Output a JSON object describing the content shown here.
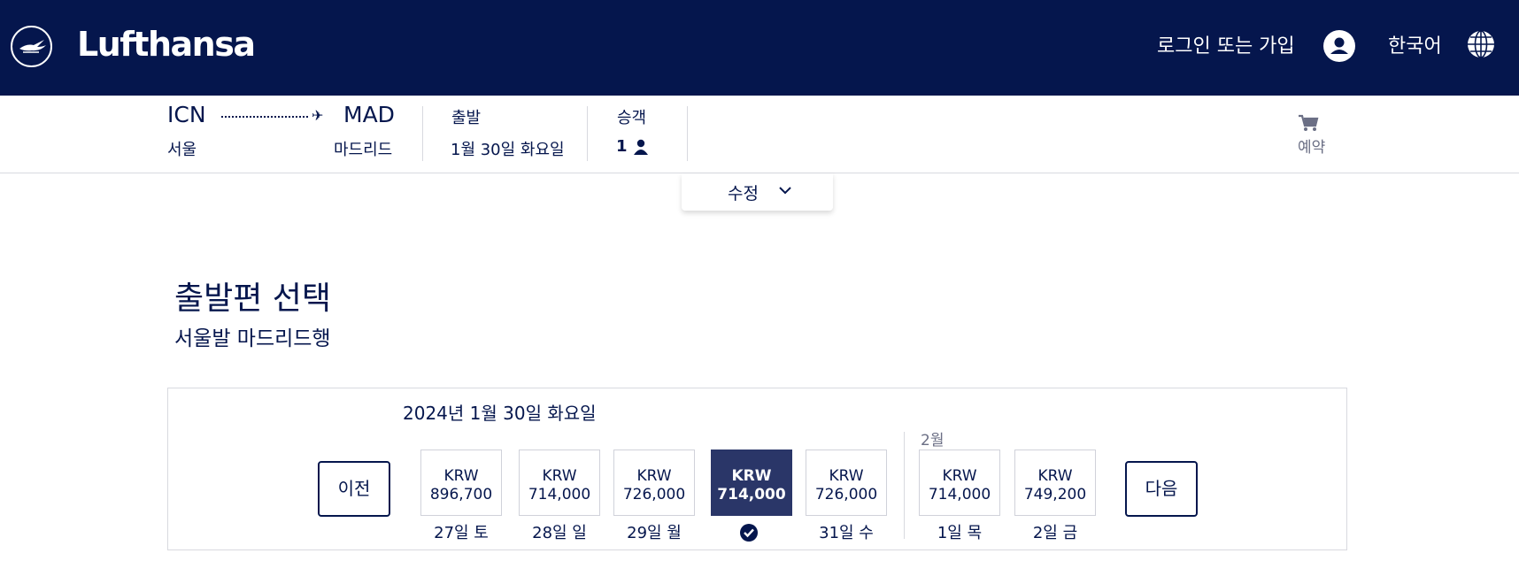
{
  "header": {
    "brand": "Lufthansa",
    "login": "로그인 또는 가입",
    "language": "한국어"
  },
  "trip": {
    "origin_code": "ICN",
    "origin_city": "서울",
    "dest_code": "MAD",
    "dest_city": "마드리드",
    "depart_label": "출발",
    "depart_date": "1월 30일 화요일",
    "pax_label": "승객",
    "pax_count": "1",
    "booking_label": "예약"
  },
  "modify": {
    "label": "수정"
  },
  "page": {
    "title": "출발편 선택",
    "subtitle": "서울발 마드리드행"
  },
  "date_selector": {
    "selected_date": "2024년 1월 30일 화요일",
    "next_month": "2월",
    "prev_label": "이전",
    "next_label": "다음",
    "fares": [
      {
        "currency": "KRW",
        "amount": "896,700",
        "day": "27일 토",
        "selected": false
      },
      {
        "currency": "KRW",
        "amount": "714,000",
        "day": "28일 일",
        "selected": false
      },
      {
        "currency": "KRW",
        "amount": "726,000",
        "day": "29일 월",
        "selected": false
      },
      {
        "currency": "KRW",
        "amount": "714,000",
        "day": "",
        "selected": true
      },
      {
        "currency": "KRW",
        "amount": "726,000",
        "day": "31일 수",
        "selected": false
      },
      {
        "currency": "KRW",
        "amount": "714,000",
        "day": "1일 목",
        "selected": false
      },
      {
        "currency": "KRW",
        "amount": "749,200",
        "day": "2일 금",
        "selected": false
      }
    ]
  },
  "colors": {
    "brand_navy": "#05164d",
    "selected_fare": "#2a3668",
    "border": "#d8d9df"
  },
  "icons": [
    "crane-logo-icon",
    "user-icon",
    "globe-icon",
    "plane-icon",
    "passenger-icon",
    "cart-icon",
    "chevron-down-icon",
    "check-circle-icon"
  ]
}
